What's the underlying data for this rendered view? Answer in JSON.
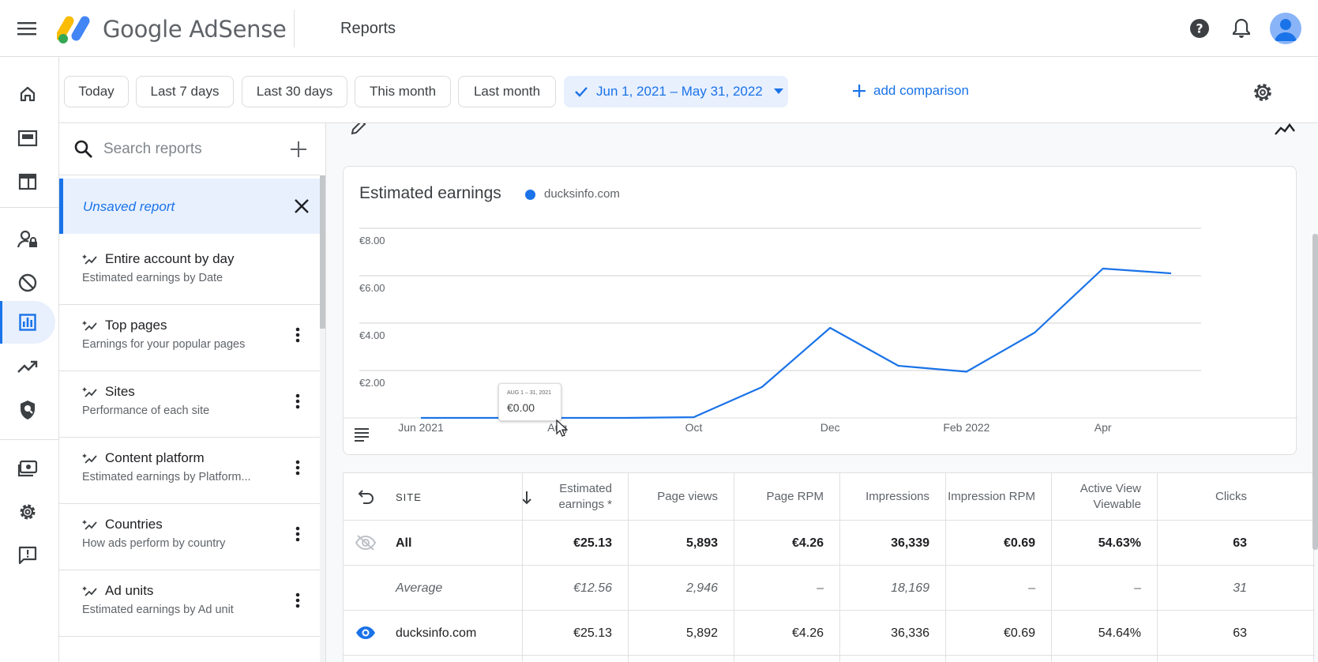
{
  "header": {
    "brand": "Google AdSense",
    "page_title": "Reports"
  },
  "rail": {
    "items": [
      {
        "name": "home-icon"
      },
      {
        "name": "ads-icon"
      },
      {
        "name": "sites-icon"
      },
      {
        "name": "privacy-icon"
      },
      {
        "name": "blocking-icon"
      },
      {
        "name": "reports-icon",
        "active": true
      },
      {
        "name": "optimization-icon"
      },
      {
        "name": "policy-icon"
      },
      {
        "name": "payments-icon"
      },
      {
        "name": "settings-icon"
      },
      {
        "name": "feedback-icon"
      }
    ]
  },
  "datebar": {
    "chips": [
      "Today",
      "Last 7 days",
      "Last 30 days",
      "This month",
      "Last month"
    ],
    "selected_range": "Jun 1, 2021 – May 31, 2022",
    "add_comparison": "add comparison"
  },
  "panel": {
    "search_placeholder": "Search reports",
    "unsaved": "Unsaved report",
    "reports": [
      {
        "title": "Entire account by day",
        "subtitle": "Estimated earnings by Date",
        "more": false
      },
      {
        "title": "Top pages",
        "subtitle": "Earnings for your popular pages",
        "more": true
      },
      {
        "title": "Sites",
        "subtitle": "Performance of each site",
        "more": true
      },
      {
        "title": "Content platform",
        "subtitle": "Estimated earnings by Platform...",
        "more": true
      },
      {
        "title": "Countries",
        "subtitle": "How ads perform by country",
        "more": true
      },
      {
        "title": "Ad units",
        "subtitle": "Estimated earnings by Ad unit",
        "more": true
      }
    ]
  },
  "chart": {
    "title": "Estimated earnings",
    "legend": "ducksinfo.com",
    "tooltip_date": "AUG 1 – 31, 2021",
    "tooltip_value": "€0.00"
  },
  "chart_data": {
    "type": "line",
    "title": "Estimated earnings",
    "x": [
      "Jun 2021",
      "Jul 2021",
      "Aug 2021",
      "Sep 2021",
      "Oct 2021",
      "Nov 2021",
      "Dec 2021",
      "Jan 2022",
      "Feb 2022",
      "Mar 2022",
      "Apr 2022",
      "May 2022"
    ],
    "x_tick_labels": [
      "Jun 2021",
      "Aug",
      "Oct",
      "Dec",
      "Feb 2022",
      "Apr"
    ],
    "series": [
      {
        "name": "ducksinfo.com",
        "color": "#1a73e8",
        "values": [
          0.0,
          0.0,
          0.0,
          0.0,
          0.03,
          1.3,
          3.8,
          2.2,
          1.95,
          3.6,
          6.3,
          6.1
        ]
      }
    ],
    "y_ticks": [
      "€2.00",
      "€4.00",
      "€6.00",
      "€8.00"
    ],
    "ylim": [
      0,
      8
    ],
    "grid": true,
    "legend_position": "top-left"
  },
  "table": {
    "headers": {
      "site": "SITE",
      "estimated_earnings": "Estimated earnings *",
      "page_views": "Page views",
      "page_rpm": "Page RPM",
      "impressions": "Impressions",
      "impression_rpm": "Impression RPM",
      "active_view": "Active View Viewable",
      "clicks": "Clicks"
    },
    "rows": [
      {
        "site": "All",
        "earnings": "€25.13",
        "page_views": "5,893",
        "page_rpm": "€4.26",
        "impressions": "36,339",
        "impression_rpm": "€0.69",
        "active_view": "54.63%",
        "clicks": "63",
        "style": "bold",
        "icon": "visibility-off-icon"
      },
      {
        "site": "Average",
        "earnings": "€12.56",
        "page_views": "2,946",
        "page_rpm": "–",
        "impressions": "18,169",
        "impression_rpm": "–",
        "active_view": "–",
        "clicks": "31",
        "style": "italic",
        "icon": ""
      },
      {
        "site": "ducksinfo.com",
        "earnings": "€25.13",
        "page_views": "5,892",
        "page_rpm": "€4.26",
        "impressions": "36,336",
        "impression_rpm": "€0.69",
        "active_view": "54.64%",
        "clicks": "63",
        "style": "normal",
        "icon": "visibility-icon"
      }
    ]
  },
  "colors": {
    "accent": "#1a73e8",
    "selected_bg": "#e8f0fe"
  }
}
